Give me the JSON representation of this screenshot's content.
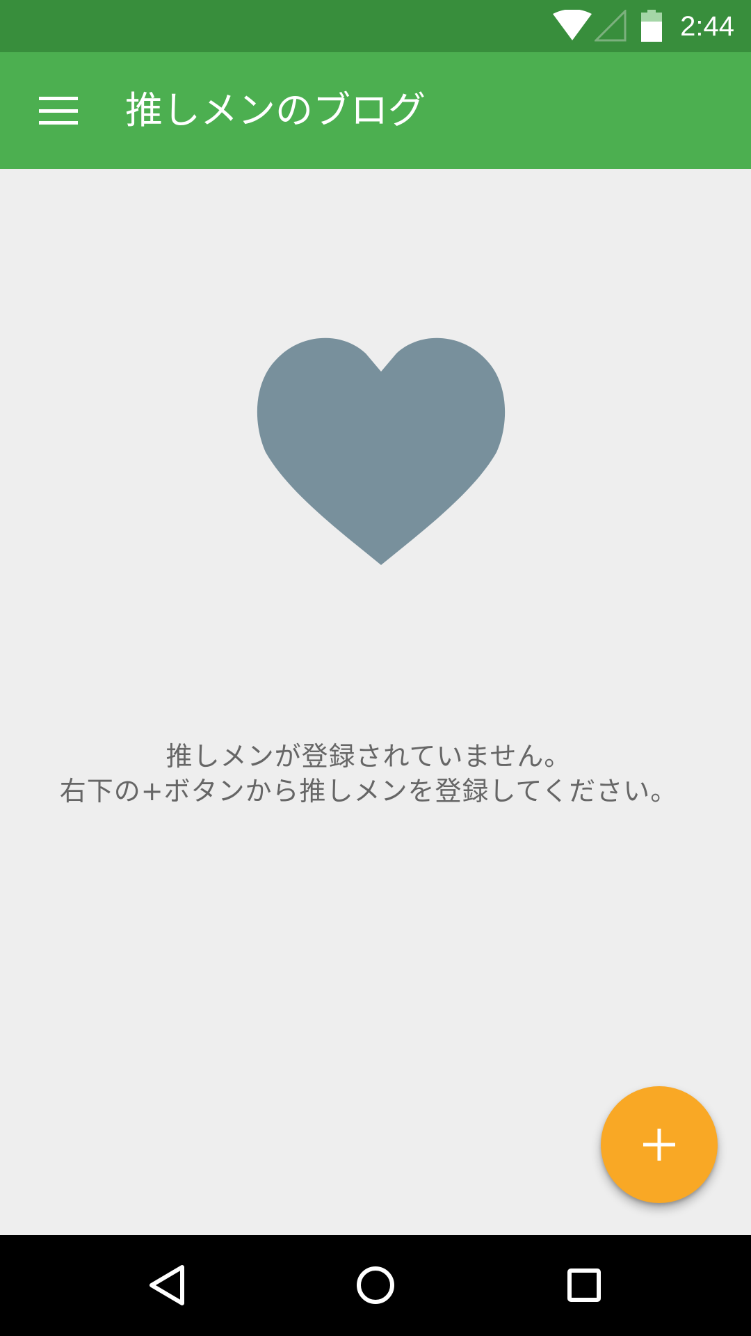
{
  "status_bar": {
    "time": "2:44",
    "icons": [
      "wifi-icon",
      "cell-signal-icon",
      "battery-icon"
    ]
  },
  "app_bar": {
    "title": "推しメンのブログ",
    "menu_icon": "hamburger-menu-icon"
  },
  "empty_state": {
    "icon": "heart-icon",
    "line1": "推しメンが登録されていません。",
    "line2": "右下の+ボタンから推しメンを登録してください。"
  },
  "fab": {
    "icon": "plus-icon"
  },
  "nav_bar": {
    "buttons": [
      "back-icon",
      "home-icon",
      "recents-icon"
    ]
  },
  "colors": {
    "status_bar": "#388E3C",
    "app_bar": "#4CAF50",
    "background": "#EEEEEE",
    "heart": "#78909C",
    "message_text": "#666666",
    "fab": "#F9A825",
    "nav_bar": "#000000"
  }
}
